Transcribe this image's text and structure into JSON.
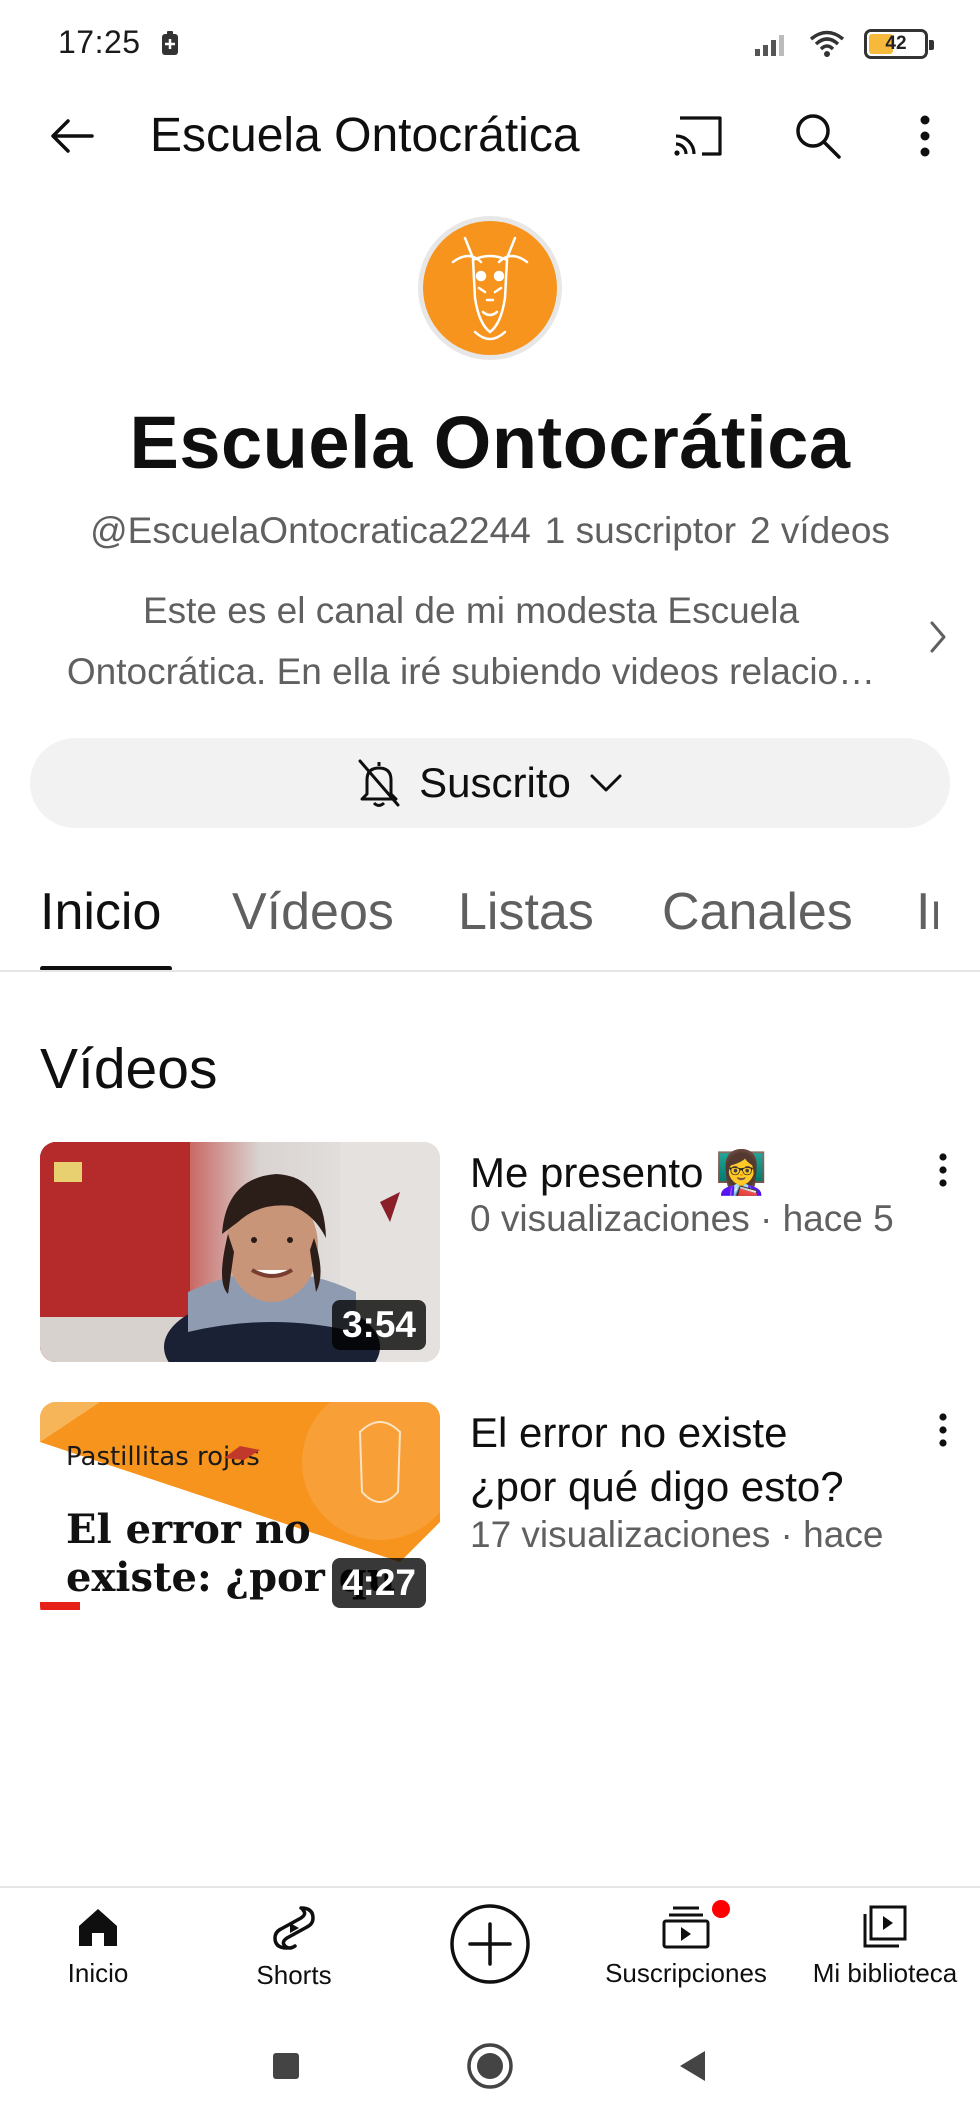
{
  "status_bar": {
    "time": "17:25",
    "battery_level": "42",
    "battery_fraction": 0.42
  },
  "app_bar": {
    "title": "Escuela Ontocrática"
  },
  "channel": {
    "name": "Escuela Ontocrática",
    "handle": "@EscuelaOntocratica2244",
    "subscribers": "1 suscriptor",
    "videos_count": "2 vídeos",
    "description_line1": "Este es el canal de mi modesta Escuela",
    "description_line2": "Ontocrática. En ella iré subiendo videos relacio…",
    "avatar_color": "#f7941d"
  },
  "subscribe": {
    "label": "Suscrito"
  },
  "tabs": [
    {
      "label": "Inicio",
      "active": true
    },
    {
      "label": "Vídeos",
      "active": false
    },
    {
      "label": "Listas",
      "active": false
    },
    {
      "label": "Canales",
      "active": false
    },
    {
      "label": "In",
      "active": false
    }
  ],
  "section": {
    "title": "Vídeos"
  },
  "videos": [
    {
      "title": "Me presento 👩‍🏫",
      "meta": "0 visualizaciones · hace 5",
      "duration": "3:54"
    },
    {
      "title_line1": "El error no existe",
      "title_line2": "¿por qué digo esto?",
      "meta": "17 visualizaciones · hace",
      "duration": "4:27",
      "thumb_small_text": "Pastillitas rojas",
      "thumb_big_line1": "El error no",
      "thumb_big_line2": "existe: ¿por qu"
    }
  ],
  "bottom_nav": [
    {
      "label": "Inicio",
      "icon": "home-icon"
    },
    {
      "label": "Shorts",
      "icon": "shorts-icon"
    },
    {
      "label": "",
      "icon": "create-icon"
    },
    {
      "label": "Suscripciones",
      "icon": "subscriptions-icon"
    },
    {
      "label": "Mi biblioteca",
      "icon": "library-icon"
    }
  ],
  "colors": {
    "accent_red": "#ff0000",
    "text_primary": "#0f0f0f",
    "text_secondary": "#606060",
    "brand_orange": "#f7941d"
  }
}
